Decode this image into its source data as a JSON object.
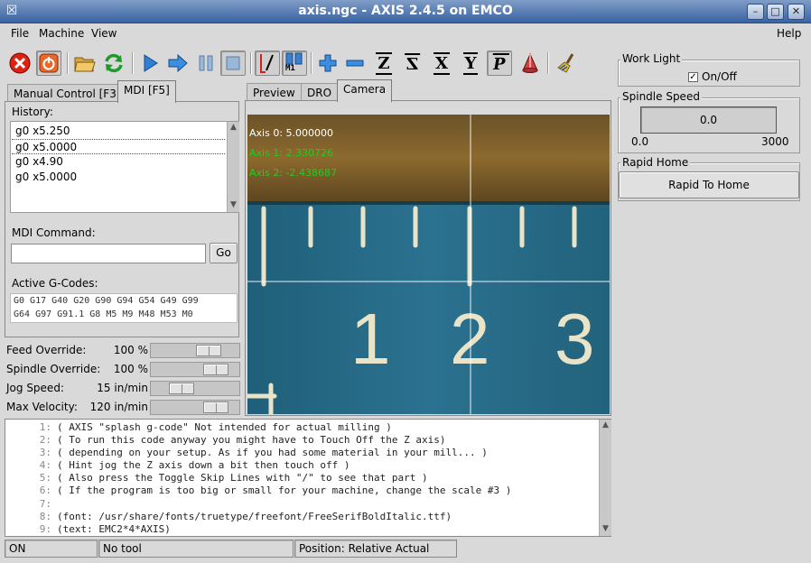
{
  "window": {
    "title": "axis.ngc - AXIS 2.4.5 on EMCO",
    "buttons": {
      "minimize": "–",
      "maximize": "□",
      "close": "✕"
    }
  },
  "menubar": {
    "file": "File",
    "machine": "Machine",
    "view": "View",
    "help": "Help"
  },
  "toolbar": {
    "axis_x": "X",
    "axis_y": "Y",
    "axis_z": "Z",
    "axis_z2": "Z",
    "axis_p": "P",
    "m1": "M1"
  },
  "left_tabs": {
    "manual": "Manual Control [F3]",
    "mdi": "MDI [F5]"
  },
  "mdi": {
    "history_label": "History:",
    "history": [
      "g0 x5.250",
      "g0 x5.0000",
      "g0 x4.90",
      "g0 x5.0000"
    ],
    "command_label": "MDI Command:",
    "command_value": "",
    "go_label": "Go",
    "active_label": "Active G-Codes:",
    "active_line1": "G0 G17 G40 G20 G90 G94 G54 G49 G99",
    "active_line2": "G64 G97 G91.1 G8 M5 M9 M48 M53 M0"
  },
  "overrides": [
    {
      "label": "Feed Override:",
      "value": "100 %",
      "level": 0.74
    },
    {
      "label": "Spindle Override:",
      "value": "100 %",
      "level": 0.85
    },
    {
      "label": "Jog Speed:",
      "value": "15 in/min",
      "level": 0.3
    },
    {
      "label": "Max Velocity:",
      "value": "120 in/min",
      "level": 0.85
    }
  ],
  "view_tabs": {
    "preview": "Preview",
    "dro": "DRO",
    "camera": "Camera"
  },
  "camera": {
    "axis0": "Axis 0: 5.000000",
    "axis1": "Axis 1: 2.330726",
    "axis2": "Axis 2: -2.438687",
    "axis0_color": "#ffffff",
    "axis_color": "#22cc22",
    "scale_numbers": [
      "1",
      "2",
      "3"
    ]
  },
  "right_panel": {
    "work_light_title": "Work Light",
    "work_light_checkbox": "On/Off",
    "work_light_checked": true,
    "spindle_title": "Spindle Speed",
    "spindle_value": "0.0",
    "spindle_min": "0.0",
    "spindle_max": "3000",
    "rapid_title": "Rapid Home",
    "rapid_button": "Rapid To Home"
  },
  "code": [
    {
      "n": "1:",
      "t": "( AXIS \"splash g-code\" Not intended for actual milling )"
    },
    {
      "n": "2:",
      "t": "( To run this code anyway you might have to Touch Off the Z axis)"
    },
    {
      "n": "3:",
      "t": "( depending on your setup. As if you had some material in your mill... )"
    },
    {
      "n": "4:",
      "t": "( Hint jog the Z axis down a bit then touch off )"
    },
    {
      "n": "5:",
      "t": "( Also press the Toggle Skip Lines with \"/\" to see that part )"
    },
    {
      "n": "6:",
      "t": "( If the program is too big or small for your machine, change the scale #3 )"
    },
    {
      "n": "7:",
      "t": ""
    },
    {
      "n": "8:",
      "t": "(font: /usr/share/fonts/truetype/freefont/FreeSerifBoldItalic.ttf)"
    },
    {
      "n": "9:",
      "t": "(text: EMC2*4*AXIS)"
    }
  ],
  "status": {
    "state": "ON",
    "tool": "No tool",
    "position": "Position: Relative Actual"
  }
}
